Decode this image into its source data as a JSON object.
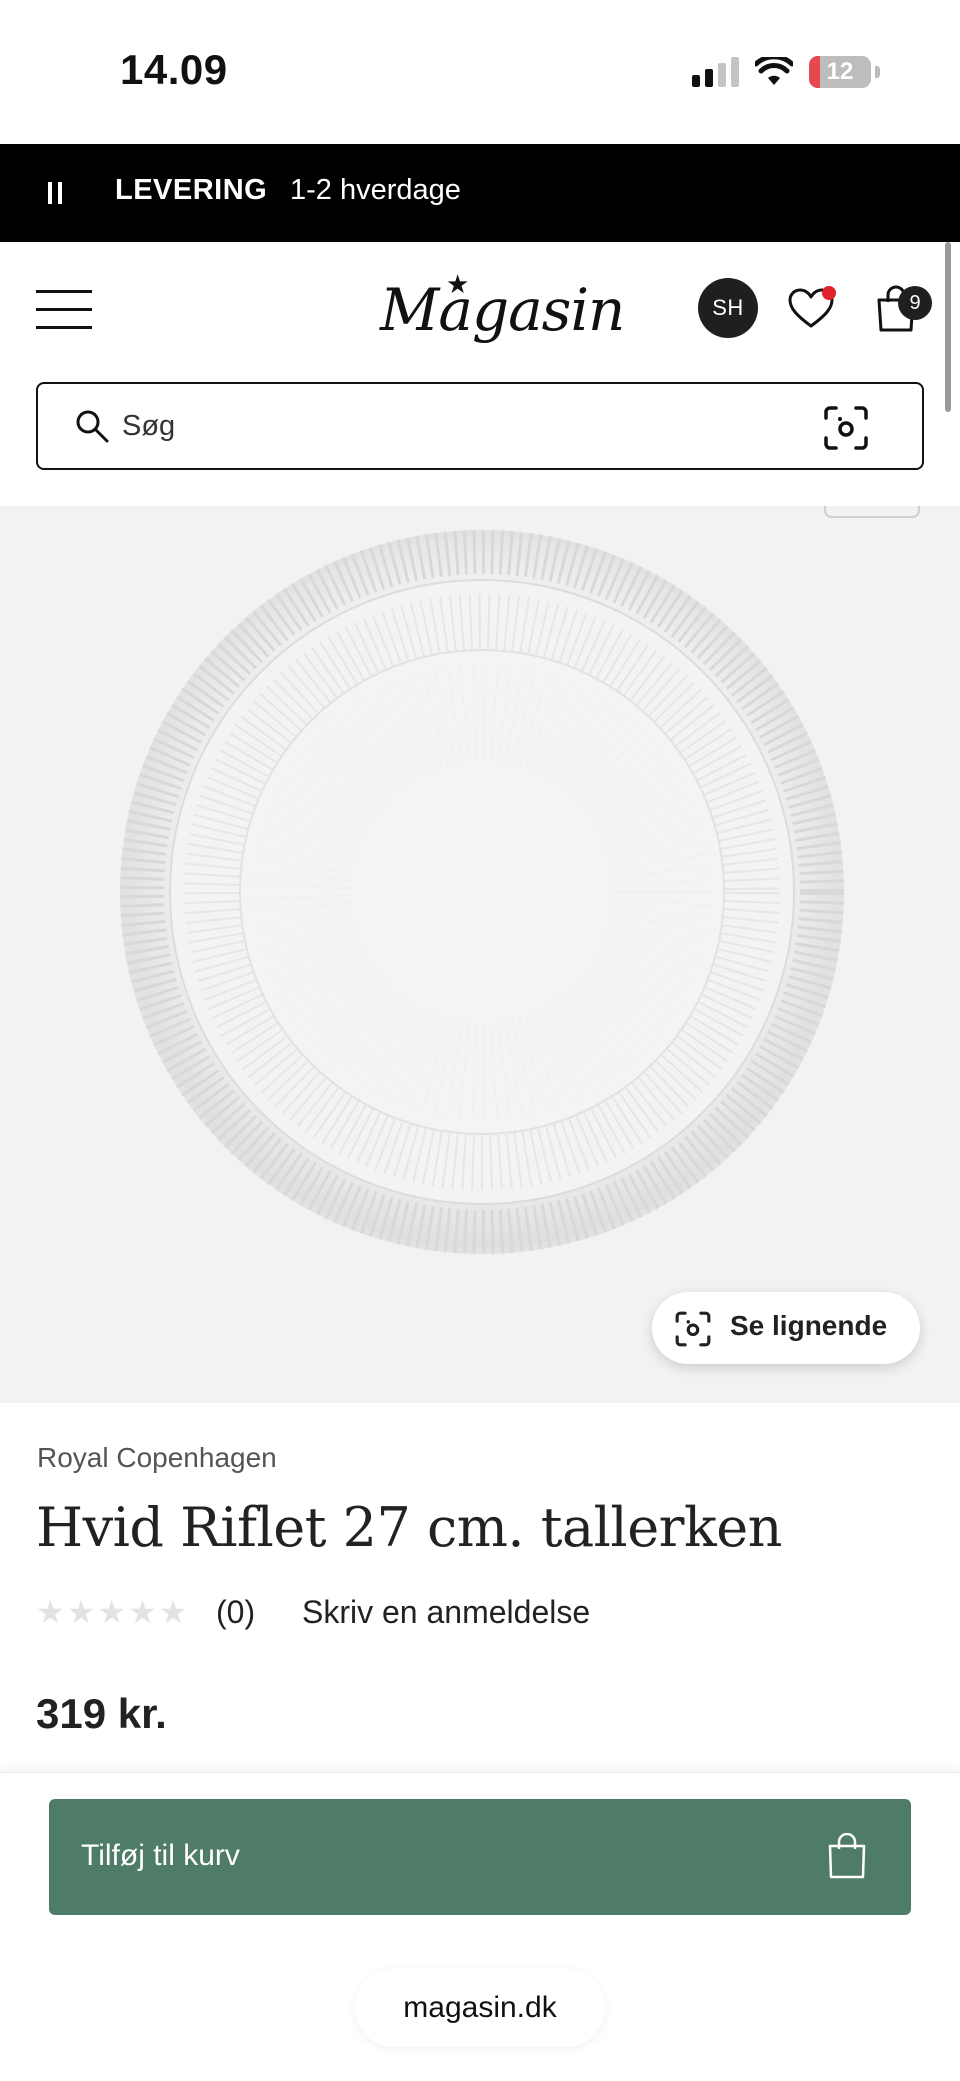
{
  "status_bar": {
    "time": "14.09",
    "battery": "12"
  },
  "promo": {
    "label": "LEVERING",
    "text": "1-2 hverdage"
  },
  "header": {
    "logo": "Magasin",
    "avatar_initials": "SH",
    "cart_count": "9",
    "search_placeholder": "Søg"
  },
  "product": {
    "similar_label": "Se lignende",
    "brand": "Royal Copenhagen",
    "title": "Hvid Riflet 27 cm. tallerken",
    "rating_stars": 0,
    "review_count": "(0)",
    "review_link": "Skriv en anmeldelse",
    "price": "319 kr."
  },
  "cart": {
    "add_label": "Tilføj til kurv"
  },
  "browser": {
    "url": "magasin.dk"
  },
  "colors": {
    "accent": "#4e7c68",
    "promo_bg": "#000000",
    "notification_dot": "#e0232a",
    "image_bg": "#f2f2f2"
  }
}
